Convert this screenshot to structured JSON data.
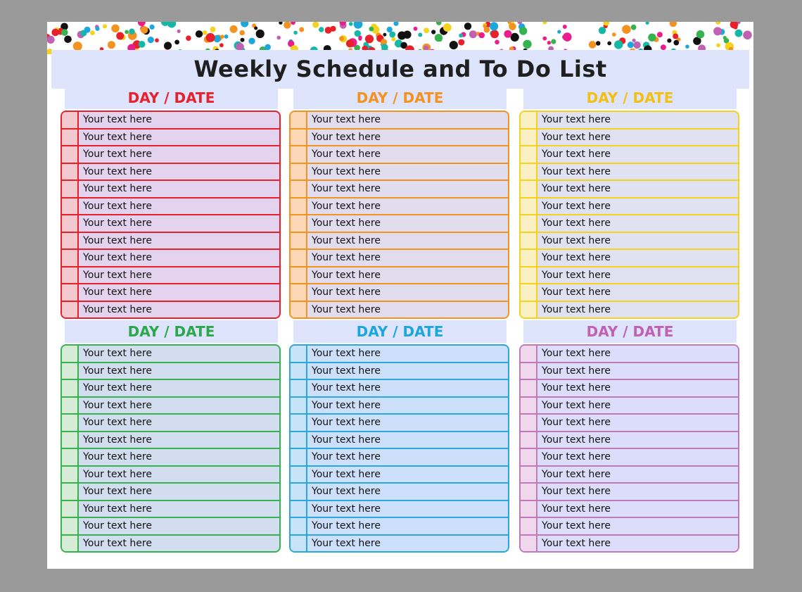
{
  "title": "Weekly Schedule and To Do List",
  "colors": {
    "red": "#e8202a",
    "orange": "#f4921f",
    "yellow": "#f5d21d",
    "green": "#36b24e",
    "blue": "#2aa7e0",
    "purple": "#c07ab8",
    "header_band": "#dfe4fd"
  },
  "panels": [
    {
      "header": "DAY / DATE",
      "rows": [
        "Your text here",
        "Your text here",
        "Your text here",
        "Your text here",
        "Your text here",
        "Your text here",
        "Your text here",
        "Your text here",
        "Your text here",
        "Your text here",
        "Your text here",
        "Your text here"
      ]
    },
    {
      "header": "DAY / DATE",
      "rows": [
        "Your text here",
        "Your text here",
        "Your text here",
        "Your text here",
        "Your text here",
        "Your text here",
        "Your text here",
        "Your text here",
        "Your text here",
        "Your text here",
        "Your text here",
        "Your text here"
      ]
    },
    {
      "header": "DAY / DATE",
      "rows": [
        "Your text here",
        "Your text here",
        "Your text here",
        "Your text here",
        "Your text here",
        "Your text here",
        "Your text here",
        "Your text here",
        "Your text here",
        "Your text here",
        "Your text here",
        "Your text here"
      ]
    },
    {
      "header": "DAY / DATE",
      "rows": [
        "Your text here",
        "Your text here",
        "Your text here",
        "Your text here",
        "Your text here",
        "Your text here",
        "Your text here",
        "Your text here",
        "Your text here",
        "Your text here",
        "Your text here",
        "Your text here"
      ]
    },
    {
      "header": "DAY / DATE",
      "rows": [
        "Your text here",
        "Your text here",
        "Your text here",
        "Your text here",
        "Your text here",
        "Your text here",
        "Your text here",
        "Your text here",
        "Your text here",
        "Your text here",
        "Your text here",
        "Your text here"
      ]
    },
    {
      "header": "DAY / DATE",
      "rows": [
        "Your text here",
        "Your text here",
        "Your text here",
        "Your text here",
        "Your text here",
        "Your text here",
        "Your text here",
        "Your text here",
        "Your text here",
        "Your text here",
        "Your text here",
        "Your text here"
      ]
    }
  ]
}
